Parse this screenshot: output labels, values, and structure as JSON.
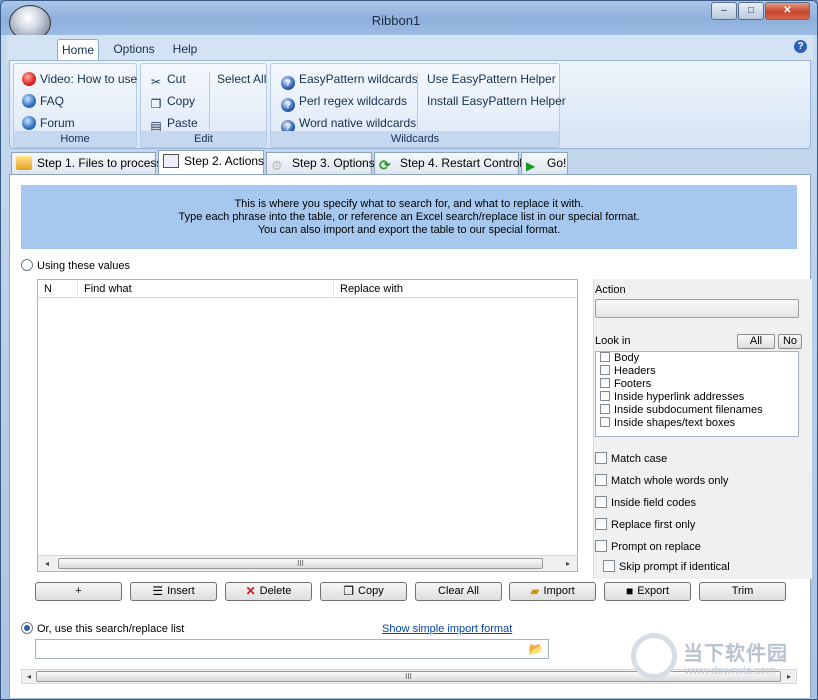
{
  "window": {
    "title": "Ribbon1",
    "controls": {
      "minimize": "–",
      "maximize": "□",
      "close": "✕"
    }
  },
  "ribbon": {
    "tabs": [
      "Home",
      "Options",
      "Help"
    ],
    "help_icon": "?",
    "groups": {
      "home": {
        "label": "Home",
        "items": [
          "Video: How to use",
          "FAQ",
          "Forum"
        ]
      },
      "edit": {
        "label": "Edit",
        "items": [
          "Cut",
          "Copy",
          "Paste",
          "Select All"
        ]
      },
      "wildcards": {
        "label": "Wildcards",
        "items": [
          "EasyPattern wildcards",
          "Perl regex wildcards",
          "Word native wildcards",
          "Use EasyPattern Helper",
          "Install EasyPattern Helper"
        ]
      }
    }
  },
  "wizard": {
    "tabs": [
      "Step 1. Files to process",
      "Step 2. Actions",
      "Step 3. Options",
      "Step 4. Restart Control",
      "Go!"
    ],
    "active_tab": "Step 2. Actions"
  },
  "info": {
    "line1": "This is where you specify what to search for, and what to replace it with.",
    "line2": "Type each phrase into the table, or reference an Excel search/replace list in our special format.",
    "line3": "You can also import and export the table to our special format."
  },
  "values_option": {
    "label": "Using these values",
    "selected": false
  },
  "grid": {
    "columns": [
      "N",
      "Find what",
      "Replace with"
    ],
    "scroll_thumb": "III"
  },
  "action": {
    "label": "Action"
  },
  "look_in": {
    "label": "Look in",
    "all_button": "All",
    "none_button": "No",
    "items": [
      "Body",
      "Headers",
      "Footers",
      "Inside hyperlink addresses",
      "Inside subdocument filenames",
      "Inside shapes/text boxes"
    ]
  },
  "options": [
    "Match case",
    "Match whole words only",
    "Inside field codes",
    "Replace first only",
    "Prompt on replace",
    "Skip prompt if identical"
  ],
  "buttons": {
    "add": "+",
    "insert": "Insert",
    "delete": "Delete",
    "copy": "Copy",
    "clear_all": "Clear All",
    "import": "Import",
    "export": "Export",
    "trim": "Trim"
  },
  "list_option": {
    "label": "Or, use this search/replace list",
    "selected": true,
    "link": "Show simple import format"
  },
  "watermark": {
    "cn": "当下软件园",
    "url": "www.downxia.com"
  },
  "colors": {
    "info_bg": "#a6c8ef",
    "ribbon_bg": "#d6e4f5",
    "link": "#0645ad"
  }
}
